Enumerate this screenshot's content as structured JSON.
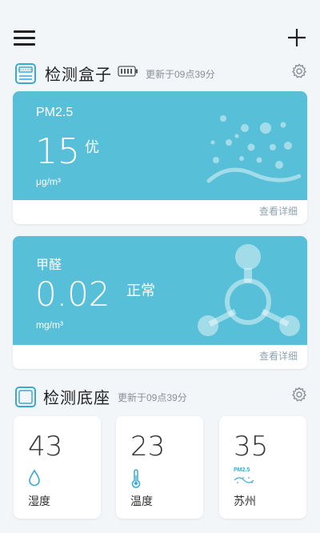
{
  "toolbar": {
    "menu_icon": "menu-icon",
    "add_icon": "plus-icon"
  },
  "box_section": {
    "title": "检测盒子",
    "updated": "更新于09点39分",
    "icon": "monitor-box-icon",
    "battery_icon": "battery-icon",
    "settings_icon": "gear-icon"
  },
  "pm_card": {
    "name": "PM2.5",
    "value": "15",
    "grade": "优",
    "unit": "μg/m³",
    "detail": "查看详细",
    "color": "#58bfd8"
  },
  "formaldehyde_card": {
    "name": "甲醛",
    "value": "0.02",
    "grade": "正常",
    "unit": "mg/m³",
    "detail": "查看详细",
    "color": "#58bfd8"
  },
  "base_section": {
    "title": "检测底座",
    "updated": "更新于09点39分",
    "icon": "base-station-icon",
    "settings_icon": "gear-icon"
  },
  "tiles": [
    {
      "value": "43",
      "label": "湿度",
      "icon": "water-drop-icon"
    },
    {
      "value": "23",
      "label": "温度",
      "icon": "thermometer-icon"
    },
    {
      "value": "35",
      "label": "苏州",
      "icon": "pm25-outdoor-icon",
      "icon_text": "PM2.5"
    }
  ],
  "accent_color": "#3aa9d6"
}
